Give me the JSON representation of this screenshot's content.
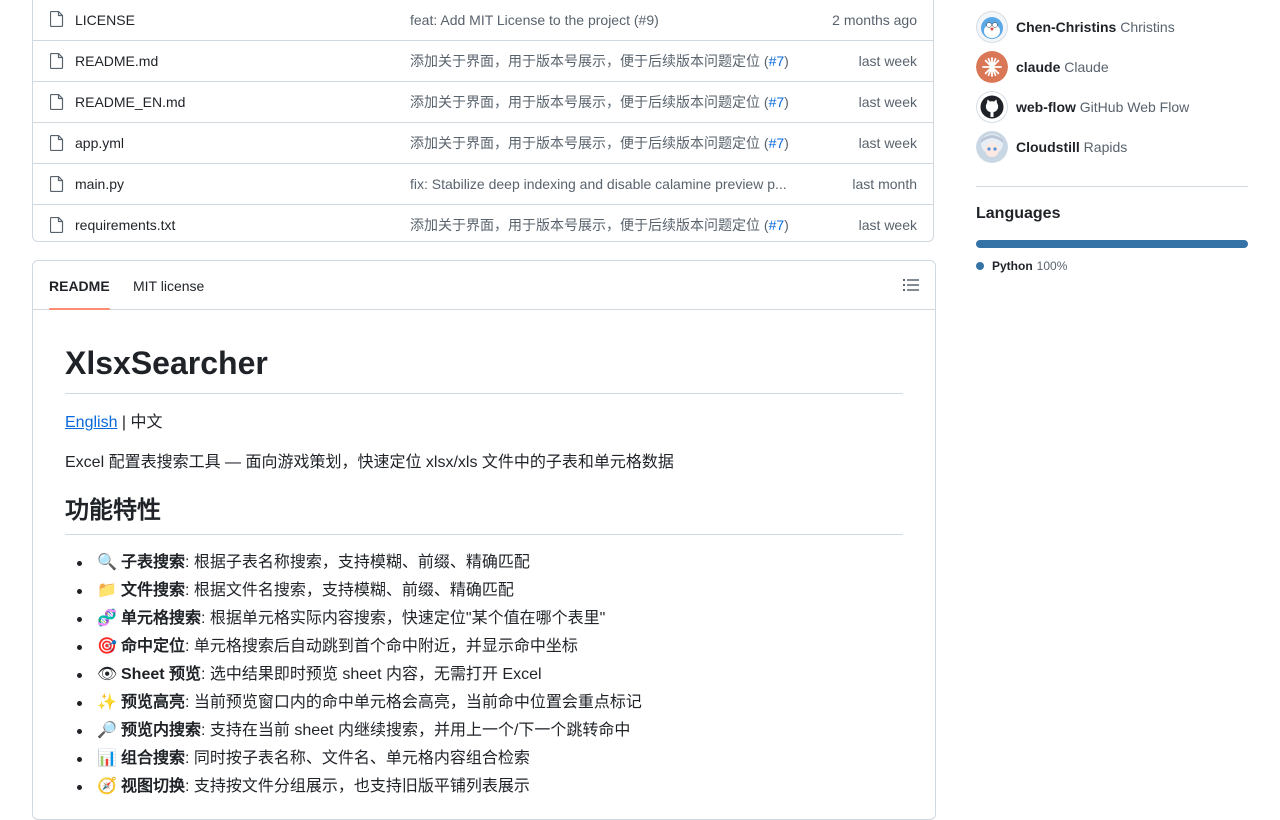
{
  "files": [
    {
      "name": "LICENSE",
      "message": "feat: Add MIT License to the project (#9)",
      "pr": "",
      "time": "2 months ago"
    },
    {
      "name": "README.md",
      "message": "添加关于界面，用于版本号展示，便于后续版本问题定位 (",
      "pr": "#7",
      "time": "last week"
    },
    {
      "name": "README_EN.md",
      "message": "添加关于界面，用于版本号展示，便于后续版本问题定位 (",
      "pr": "#7",
      "time": "last week"
    },
    {
      "name": "app.yml",
      "message": "添加关于界面，用于版本号展示，便于后续版本问题定位 (",
      "pr": "#7",
      "time": "last week"
    },
    {
      "name": "main.py",
      "message": "fix: Stabilize deep indexing and disable calamine preview p...",
      "pr": "",
      "time": "last month"
    },
    {
      "name": "requirements.txt",
      "message": "添加关于界面，用于版本号展示，便于后续版本问题定位 (",
      "pr": "#7",
      "time": "last week"
    }
  ],
  "readme": {
    "tabs": {
      "readme": "README",
      "license": "MIT license"
    },
    "title": "XlsxSearcher",
    "lang_link": "English",
    "lang_sep": " | 中文",
    "description": "Excel 配置表搜索工具 — 面向游戏策划，快速定位 xlsx/xls 文件中的子表和单元格数据",
    "features_heading": "功能特性",
    "features": [
      {
        "emoji": "🔍",
        "title": "子表搜索",
        "text": ": 根据子表名称搜索，支持模糊、前缀、精确匹配"
      },
      {
        "emoji": "📁",
        "title": "文件搜索",
        "text": ": 根据文件名搜索，支持模糊、前缀、精确匹配"
      },
      {
        "emoji": "🧬",
        "title": "单元格搜索",
        "text": ": 根据单元格实际内容搜索，快速定位\"某个值在哪个表里\""
      },
      {
        "emoji": "🎯",
        "title": "命中定位",
        "text": ": 单元格搜索后自动跳到首个命中附近，并显示命中坐标"
      },
      {
        "emoji": "👁",
        "title": "Sheet 预览",
        "text": ": 选中结果即时预览 sheet 内容，无需打开 Excel"
      },
      {
        "emoji": "✨",
        "title": "预览高亮",
        "text": ": 当前预览窗口内的命中单元格会高亮，当前命中位置会重点标记"
      },
      {
        "emoji": "🔎",
        "title": "预览内搜索",
        "text": ": 支持在当前 sheet 内继续搜索，并用上一个/下一个跳转命中"
      },
      {
        "emoji": "📊",
        "title": "组合搜索",
        "text": ": 同时按子表名称、文件名、单元格内容组合检索"
      },
      {
        "emoji": "🧭",
        "title": "视图切换",
        "text": ": 支持按文件分组展示，也支持旧版平铺列表展示"
      }
    ]
  },
  "sidebar": {
    "contributors": [
      {
        "login": "Chen-Christins",
        "name": "Christins",
        "avatar": "cartoon-avatar-icon"
      },
      {
        "login": "claude",
        "name": "Claude",
        "avatar": "claude-logo-icon"
      },
      {
        "login": "web-flow",
        "name": "GitHub Web Flow",
        "avatar": "github-octocat-icon"
      },
      {
        "login": "Cloudstill",
        "name": "Rapids",
        "avatar": "anime-avatar-icon"
      }
    ],
    "languages_title": "Languages",
    "languages": [
      {
        "name": "Python",
        "percent": "100%",
        "fraction": 1.0,
        "color": "#3572A5"
      }
    ]
  }
}
